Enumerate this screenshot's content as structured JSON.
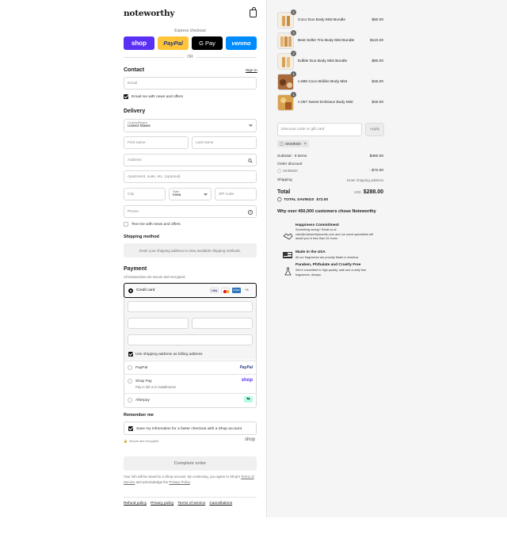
{
  "store": {
    "name": "noteworthy"
  },
  "express": {
    "label": "Express checkout",
    "buttons": [
      {
        "label": "shop",
        "bg": "#5a31f4",
        "color": "#ffffff"
      },
      {
        "label": "PayPal",
        "bg": "#ffc439",
        "color": "#253b80"
      },
      {
        "label": "G Pay",
        "bg": "#000000",
        "color": "#ffffff"
      },
      {
        "label": "venmo",
        "bg": "#008cff",
        "color": "#ffffff"
      }
    ],
    "or": "OR"
  },
  "contact": {
    "title": "Contact",
    "signin": "Sign in",
    "email_placeholder": "Email",
    "newsletter_label": "Email me with news and offers"
  },
  "delivery": {
    "title": "Delivery",
    "country_label": "Country/Region",
    "country_value": "United States",
    "first_name": "First name",
    "last_name": "Last name",
    "address": "Address",
    "apartment": "Apartment, suite, etc. (optional)",
    "city": "City",
    "state_label": "State",
    "state_value": "Iowa",
    "zip": "ZIP code",
    "phone": "Phone",
    "sms_label": "Text me with news and offers"
  },
  "shipping": {
    "title": "Shipping method",
    "message": "Enter your shipping address to view available shipping methods."
  },
  "payment": {
    "title": "Payment",
    "subtitle": "All transactions are secure and encrypted.",
    "credit_card": "Credit card",
    "more_cards": "+6",
    "billing_label": "Use shipping address as billing address",
    "paypal": "PayPal",
    "paypal_logo": "PayPal",
    "shoppay": "Shop Pay",
    "shoppay_sub": "Pay in full or in installments",
    "shoppay_logo": "shop",
    "afterpay": "Afterpay"
  },
  "remember": {
    "title": "Remember me",
    "save_label": "Save my information for a faster checkout with a Shop account",
    "secure": "Secure and encrypted",
    "shop_logo": "shop"
  },
  "complete": {
    "label": "Complete order"
  },
  "terms": {
    "before": "Your info will be saved to a Shop account. By continuing, you agree to Shop's",
    "tos": "Terms of Service",
    "middle": "and acknowledge the",
    "privacy": "Privacy Policy",
    "end": "."
  },
  "footer": {
    "links": [
      "Refund policy",
      "Privacy policy",
      "Terms of service",
      "Cancellations"
    ]
  },
  "cart": {
    "items": [
      {
        "name": "Coco Duo Body Mist Bundle",
        "price": "$80.00",
        "qty": "2"
      },
      {
        "name": "Best Seller Trio Body Mist Bundle",
        "price": "$110.00",
        "qty": "2"
      },
      {
        "name": "Edible Duo Body Mist Bundle",
        "price": "$80.00",
        "qty": "2"
      },
      {
        "name": "n.686 Coco Brûlée Body Mist",
        "price": "$45.00",
        "qty": "1"
      },
      {
        "name": "n.057 Sweet Embrace Body Mist",
        "price": "$45.00",
        "qty": "1"
      }
    ],
    "discount_placeholder": "Discount code or gift card",
    "apply": "Apply",
    "code_tag": "SKIMM20",
    "subtotal_label": "Subtotal · 8 items",
    "subtotal_value": "$360.00",
    "order_discount_label": "Order discount",
    "discount_code": "SKIMM20",
    "discount_value": "- $72.00",
    "shipping_label": "Shipping",
    "shipping_value": "Enter shipping address",
    "total_label": "Total",
    "currency": "USD",
    "total_value": "$288.00",
    "savings_label": "TOTAL SAVINGS",
    "savings_value": "$72.00"
  },
  "why": {
    "title": "Why over 450,000 customers chose Noteworthy",
    "items": [
      {
        "title": "Happiness Commitment",
        "lines": [
          "Something wrong? Email us at",
          "care@noteworthyscents.com and our scent specialists will",
          "assist you in less than 24 hours"
        ]
      },
      {
        "title": "Made in the USA",
        "lines": [
          "All our fragrances are proudly Made in America"
        ]
      },
      {
        "title": "Paraben, Phthalate and Cruelty Free",
        "lines": [
          "We're committed to high-quality, safe and cruelty free",
          "fragrances. Always."
        ]
      }
    ]
  }
}
